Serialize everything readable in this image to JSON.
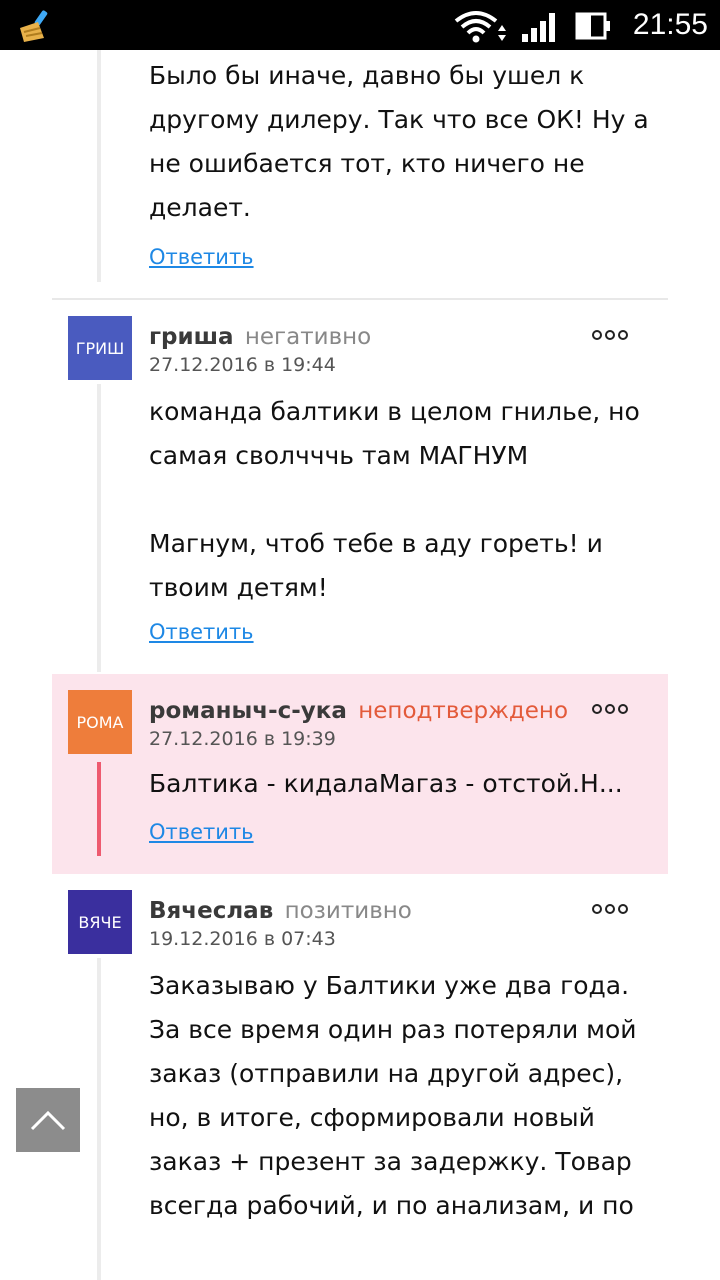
{
  "status_bar": {
    "time": "21:55"
  },
  "comments": [
    {
      "text": "Было бы иначе, давно бы ушел к другому дилеру. Так что все ОК! Ну а не ошибается тот, кто ничего не делает.",
      "reply_label": "Ответить"
    },
    {
      "avatar_text": "ГРИШ",
      "avatar_color": "#4a5bbf",
      "author": "гриша",
      "sentiment": "негативно",
      "date": "27.12.2016 в 19:44",
      "text_1": "команда балтики в целом гнилье, но самая сволчччь там МАГНУМ",
      "text_2": "Магнум, чтоб тебе в аду гореть! и твоим детям!",
      "reply_label": "Ответить"
    },
    {
      "avatar_text": "РОМА",
      "avatar_color": "#ee7d3b",
      "author": "романыч-с-ука",
      "sentiment": "неподтверждено",
      "date": "27.12.2016 в 19:39",
      "text": "Балтика - кидалаМагаз - отстой.Н...",
      "reply_label": "Ответить"
    },
    {
      "avatar_text": "ВЯЧЕ",
      "avatar_color": "#3a2f9e",
      "author": "Вячеслав",
      "sentiment": "позитивно",
      "date": "19.12.2016 в 07:43",
      "text": "Заказываю у Балтики уже два года. За все время один раз потеряли мой заказ (отправили на другой адрес), но, в итоге, сформировали новый заказ + презент за задержку. Товар всегда рабочий, и по анализам, и по"
    }
  ]
}
